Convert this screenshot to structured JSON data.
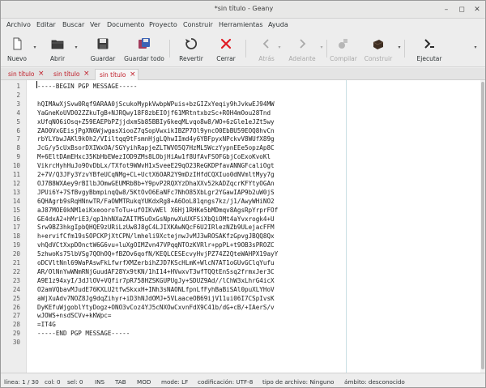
{
  "window": {
    "title": "*sin título - Geany"
  },
  "menu": [
    "Archivo",
    "Editar",
    "Buscar",
    "Ver",
    "Documento",
    "Proyecto",
    "Construir",
    "Herramientas",
    "Ayuda"
  ],
  "toolbar": {
    "nuevo": "Nuevo",
    "abrir": "Abrir",
    "guardar": "Guardar",
    "guardar_todo": "Guardar todo",
    "revertir": "Revertir",
    "cerrar": "Cerrar",
    "atras": "Atrás",
    "adelante": "Adelante",
    "compilar": "Compilar",
    "construir": "Construir",
    "ejecutar": "Ejecutar"
  },
  "tabs": [
    "sin título",
    "sin título",
    "sin título"
  ],
  "editor": {
    "lines": [
      "-----BEGIN PGP MESSAGE-----",
      "",
      "hQIMAwXjSvw0Rqf9ARAA0jScukoMypkVwbpWPuis+bzGIZxYeqiy9hJvkwEJ94MW",
      "YaGneKoUVD02ZZkuTgB+NJRQwy18F8zbEIOjf61MRtntxbzSc+ROH4mOou28Tnd",
      "xUfqNO6iOsq+Z59EAEPbPZjjdxmSb85BBIy6keqMLvqo8w8/WO+6zGle1eJZt5wy",
      "ZAO0VxGEisjPgXN6WjwgasXiooZ7qSopVwxikIBZP7Ol9yncO0EbBU59EOQ8hvCn",
      "rbYLYbwJAKl9kOh2/VIiltqq9tFsmnHjgLQhwIImd4y6YBFpyxNPckvV8WUfX89g",
      "JcG/y5cUxBsorDXIWxOA/SGYyihRapjeZLTWVO5Q7HzML5WczYypnEEe5opzAp8C",
      "M+6EltDAmEHxc35KbHbEWezIOD9ZMs8LObjHiAw1f8UfAvFSOFGbjCoExoKvoKl",
      "VikrcHyhHuJo9OvDbLx/TXfot9WWvH1xSveeE29qO23ReGKDPfavANNGFcaliOgt",
      "2+7V/Q3JFy3YzvYBfeUCqNMg+CL+UctX6OAR2Y9mDzIHfdCQXIuo0dNVmltMyy7g",
      "OJ7B8WXAey9rBIlbJOmwGEUMRbBb+Y9pvP2RQXYzDhaXXv52kADZqcrKFYtyOGAn",
      "JPUi6Y+7SfBvgyBbmpinqQw8/5KtOvO6EaNFc7NhO85XbLgr2YGawIAP9b2uW0jS",
      "6QHAgrb9sRqHNnwTR/FaOWMTRukqYUKdxRg8+A6OoL81qngs7kz/j1/AwyWHiNO2",
      "aJ87MOE0kNM1eiKxeooroToTu+ufOIKvWEl X6Hj1RHKe5bMDmqv8AgsRpYrprFOf",
      "GE4dxA2+hMriE3/qp1hhNXaZAITMSuOxGsNpnwXuUXFSiXbQiOMt4aYvxrogk4+U",
      "Srw9BZ3hkgIpbQHQE9zURiLzUw8J8gC4LJIXKAwNQcF6U2IRlezNZb9ULejacFFM",
      "h+ervifCfm19sSOPCKPjXtCPN/lmheli9XctejnwJvMJ3wROSAKfzGpvgJBQQ8Qx",
      "vhQdVCtXxpDOnctW6G6vu+luXgOIMZvn47VPqqNTOzKVRlr+ppPL+t9OB3sPROZC",
      "5zhwoKs75lbVSg7QOhOQ+fBZOv6qofN/KEQLCESEcvyHvjPZ74Z2QteWAHPX19ayY",
      "oDCVltNnl69WaPAswFkLfwrfXMZerbihZJD7KScHLmK+WlcN7AT1oGUvGClqYufu",
      "AR/OlNnYwWNmRNjGuudAF28Yx9tKN/1hI14+HVwxvT3wfTQQtEnSsq2frmxJer3C",
      "A9E1z94xyI/3dJlOV+VQfir7pR758HZSKGUPUgJy+SDUZ9Ad//lChW3xLhrG4icX",
      "O2amVQbavMJudE76KXLU2tfwSkxxH+INh3sNAONLfpnLfFyhBaBiSAl0puXLYHoV",
      "aWjXuAdv7NOZ8Jg9dqZihyr+iD3hNJdOMJ+5VLaaceOB69ijV11ui06I7CSpIvsK",
      "DyKEfuWjgoblYtyDogz+ONO3vCoz4YJ5cNXOwCxvnFdX9C41b/dG+cB/+IAerS/v",
      "wJOWS+nsdSCVv+kKWpc=",
      "=IT4G",
      "-----END PGP MESSAGE-----",
      ""
    ]
  },
  "status": {
    "linea": "línea: 1 / 30",
    "col": "col: 0",
    "sel": "sel: 0",
    "ins": "INS",
    "tab": "TAB",
    "mod": "MOD",
    "mode": "mode: LF",
    "codificacion": "codificación: UTF-8",
    "tipo": "tipo de archivo: Ninguno",
    "ambito": "ámbito: desconocido"
  },
  "colors": {
    "tab_text": "#c01c28",
    "close_icon": "#e01b24",
    "margin_line": "#c9dfe3"
  }
}
